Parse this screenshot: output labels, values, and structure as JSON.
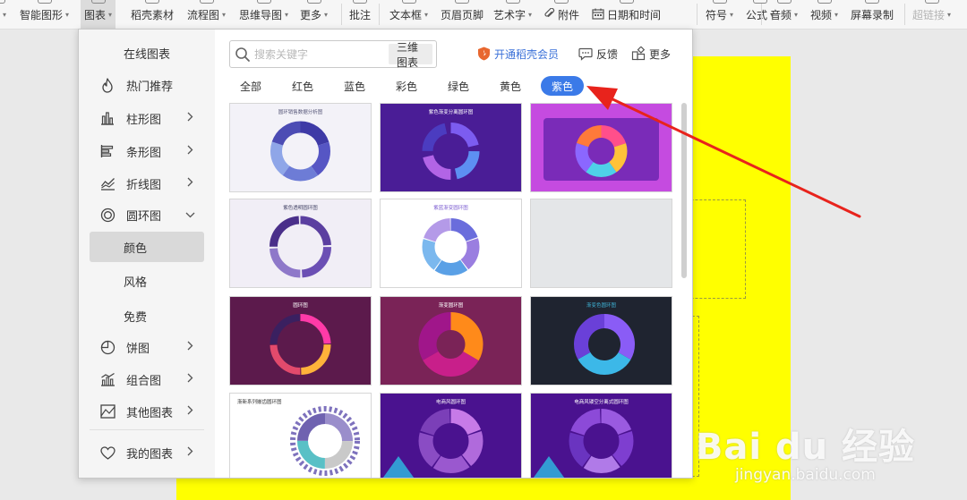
{
  "toolbar": {
    "items": [
      {
        "label": "表",
        "caret": true
      },
      {
        "label": "智能图形",
        "caret": true
      },
      {
        "label": "图表",
        "caret": true
      },
      {
        "label": "稻壳素材",
        "caret": false
      },
      {
        "label": "流程图",
        "caret": true
      },
      {
        "label": "思维导图",
        "caret": true
      },
      {
        "label": "更多",
        "caret": true
      },
      {
        "label": "批注",
        "caret": false
      },
      {
        "label": "文本框",
        "caret": true
      },
      {
        "label": "页眉页脚",
        "caret": false
      },
      {
        "label": "艺术字",
        "caret": true
      },
      {
        "label": "附件",
        "caret": false
      },
      {
        "label": "日期和时间",
        "caret": false
      },
      {
        "label": "符号",
        "caret": true
      },
      {
        "label": "公式",
        "caret": true
      },
      {
        "label": "音频",
        "caret": true
      },
      {
        "label": "视频",
        "caret": true
      },
      {
        "label": "屏幕录制",
        "caret": false
      },
      {
        "label": "超链接",
        "caret": true
      }
    ]
  },
  "dialog": {
    "sidebar": {
      "title": "在线图表",
      "items": [
        {
          "label": "热门推荐",
          "icon": "flame-icon",
          "chevron": ""
        },
        {
          "label": "柱形图",
          "icon": "bar-chart-icon",
          "chevron": "right"
        },
        {
          "label": "条形图",
          "icon": "horizontal-bar-icon",
          "chevron": "right"
        },
        {
          "label": "折线图",
          "icon": "line-chart-icon",
          "chevron": "right"
        },
        {
          "label": "圆环图",
          "icon": "donut-chart-icon",
          "chevron": "down"
        },
        {
          "label": "颜色",
          "icon": "",
          "chevron": "",
          "sub": true,
          "selected": true
        },
        {
          "label": "风格",
          "icon": "",
          "chevron": "",
          "sub": true
        },
        {
          "label": "免费",
          "icon": "",
          "chevron": "",
          "sub": true
        },
        {
          "label": "饼图",
          "icon": "pie-chart-icon",
          "chevron": "right"
        },
        {
          "label": "组合图",
          "icon": "combo-chart-icon",
          "chevron": "right"
        },
        {
          "label": "其他图表",
          "icon": "other-chart-icon",
          "chevron": "right"
        },
        {
          "label": "我的图表",
          "icon": "heart-icon",
          "chevron": "right"
        }
      ]
    },
    "search": {
      "placeholder": "搜索关键字",
      "value": "",
      "tag": "三维图表"
    },
    "vip_label": "开通稻壳会员",
    "feedback_label": "反馈",
    "more_label": "更多",
    "color_tabs": [
      {
        "label": "全部",
        "active": false
      },
      {
        "label": "红色",
        "active": false
      },
      {
        "label": "蓝色",
        "active": false
      },
      {
        "label": "彩色",
        "active": false
      },
      {
        "label": "绿色",
        "active": false
      },
      {
        "label": "黄色",
        "active": false
      },
      {
        "label": "紫色",
        "active": true
      }
    ],
    "templates": [
      {
        "title": "圆环销售数据分析图",
        "bg": "#f3f2f8",
        "title_color": "#555577",
        "style": "white"
      },
      {
        "title": "紫色渐变分离圆环图",
        "bg": "#4a1d96",
        "title_color": "#ffffff",
        "style": "violet"
      },
      {
        "title": "",
        "bg": "#c54be0",
        "title_color": "#ffffff",
        "style": "magenta"
      },
      {
        "title": "紫色透明圆环图",
        "bg": "#f1eef6",
        "title_color": "#444466",
        "style": "lavender"
      },
      {
        "title": "紫蓝渐变圆环图",
        "bg": "#ffffff",
        "title_color": "#7a5bd0",
        "style": "soft"
      },
      {
        "title": "",
        "bg": "#e4e6e8",
        "title_color": "#999999",
        "style": "empty"
      },
      {
        "title": "圆环图",
        "bg": "#5c1a4c",
        "title_color": "#ffffff",
        "style": "plum"
      },
      {
        "title": "渐变圆环图",
        "bg": "#7a2357",
        "title_color": "#ffffff",
        "style": "wine"
      },
      {
        "title": "渐变色圆环图",
        "bg": "#1f2430",
        "title_color": "#3fb5d8",
        "style": "dark"
      },
      {
        "title": "渐新系列嵌齿圆环图",
        "bg": "#ffffff",
        "title_color": "#333333",
        "style": "gear"
      },
      {
        "title": "电商风圆环图",
        "bg": "#4a128f",
        "title_color": "#ffffff",
        "style": "neon"
      },
      {
        "title": "电商风镂空分离式圆环图",
        "bg": "#4a128f",
        "title_color": "#ffffff",
        "style": "neon2"
      }
    ]
  },
  "watermark": {
    "logo": "Bai du 经验",
    "url": "jingyan.baidu.com"
  },
  "colors": {
    "accent": "#3b7ae8",
    "slide": "#ffff00",
    "arrow": "#e8231c",
    "vip": "#e8672f"
  }
}
